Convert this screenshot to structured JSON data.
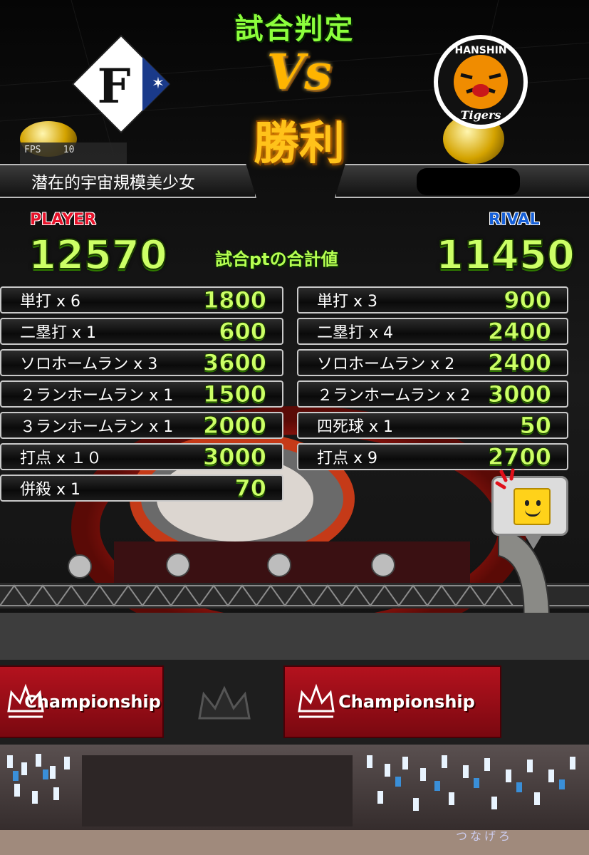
{
  "header": {
    "judge_title": "試合判定",
    "vs_label": "Vs",
    "result": "勝利"
  },
  "logos": {
    "player_team_letter": "F",
    "rival_team_name": "HANSHIN",
    "rival_team_script": "Tigers"
  },
  "fps": {
    "label": "FPS",
    "value": "10"
  },
  "player": {
    "tag": "PLAYER",
    "name": "潜在的宇宙規模美少女",
    "total": "12570",
    "rows": [
      {
        "label": "単打 x 6",
        "value": "1800"
      },
      {
        "label": "二塁打 x 1",
        "value": "600"
      },
      {
        "label": "ソロホームラン x 3",
        "value": "3600"
      },
      {
        "label": "２ランホームラン x 1",
        "value": "1500"
      },
      {
        "label": "３ランホームラン x 1",
        "value": "2000"
      },
      {
        "label": "打点 x １０",
        "value": "3000"
      },
      {
        "label": "併殺 x 1",
        "value": "70"
      }
    ]
  },
  "rival": {
    "tag": "RIVAL",
    "name": "",
    "total": "11450",
    "rows": [
      {
        "label": "単打 x 3",
        "value": "900"
      },
      {
        "label": "二塁打 x 4",
        "value": "2400"
      },
      {
        "label": "ソロホームラン x 2",
        "value": "2400"
      },
      {
        "label": "２ランホームラン x 2",
        "value": "3000"
      },
      {
        "label": "四死球 x 1",
        "value": "50"
      },
      {
        "label": "打点 x 9",
        "value": "2700"
      }
    ]
  },
  "total_caption": "試合ptの合計値",
  "banners": [
    "Championship",
    "Championship"
  ],
  "stand_text": "つなげろ",
  "icons": {
    "reaction": "smile-face-icon",
    "alert": "alert-marks-icon"
  },
  "colors": {
    "score_green": "#ccff66",
    "player_red": "#e6122a",
    "rival_blue": "#1660d8",
    "result_gold": "#ffc21a"
  }
}
